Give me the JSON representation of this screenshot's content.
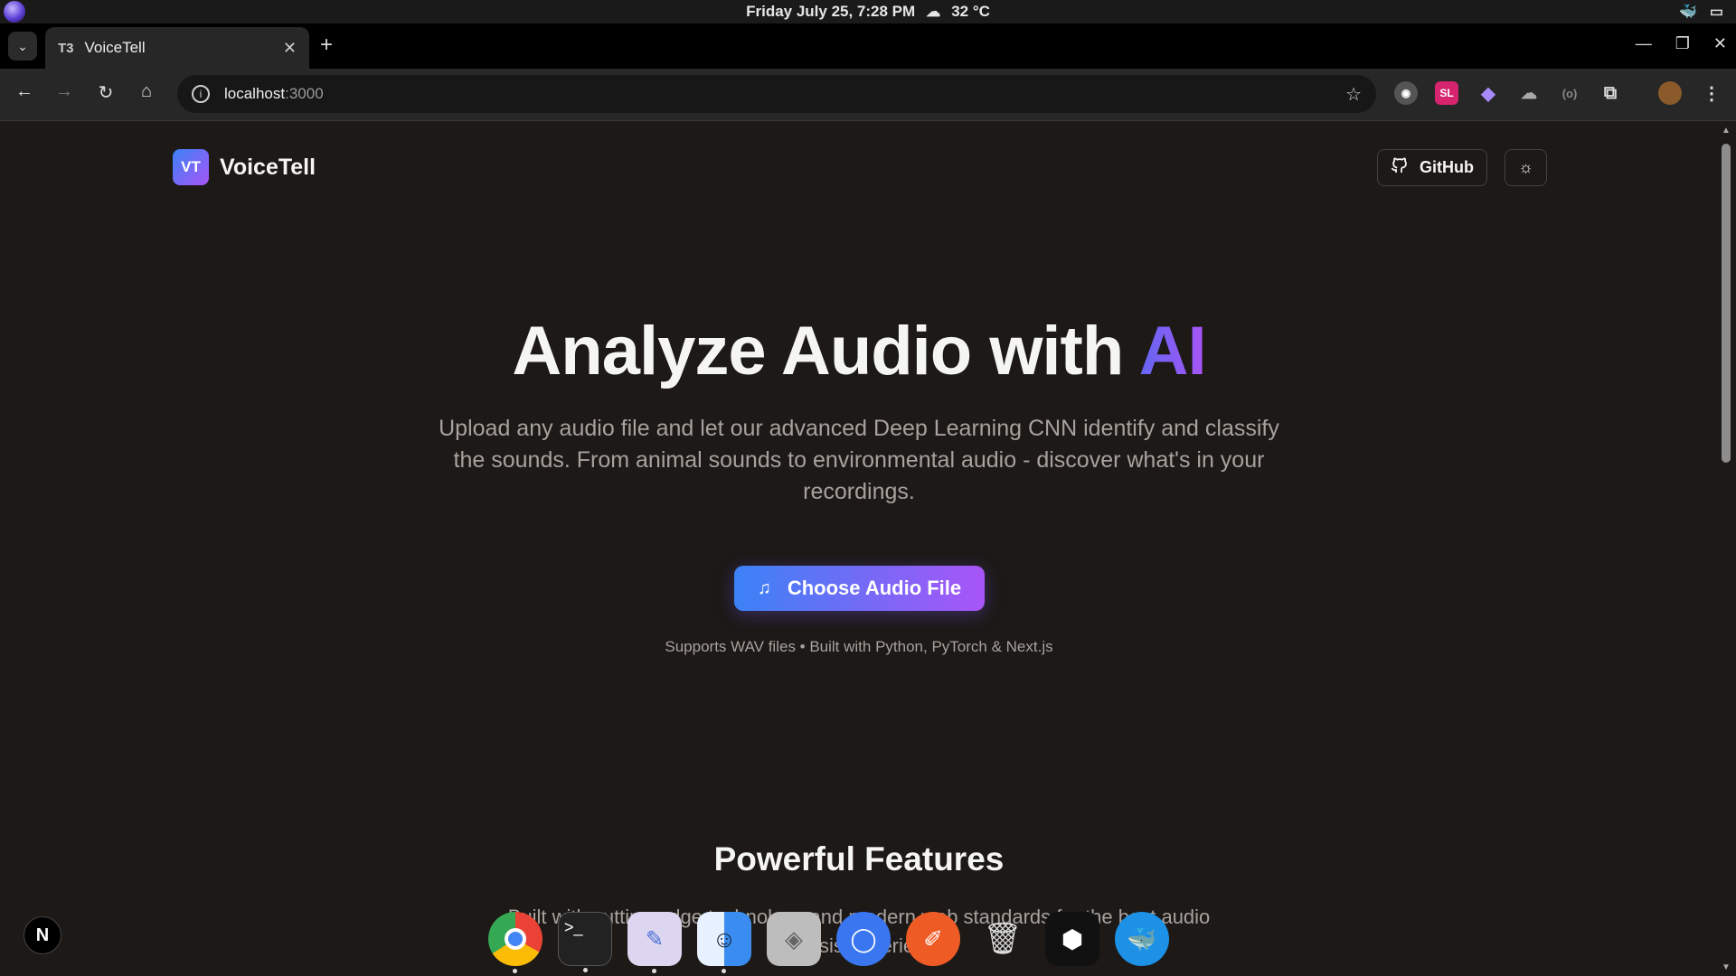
{
  "os_bar": {
    "datetime": "Friday July 25, 7:28 PM",
    "weather_icon": "cloud-icon",
    "temperature": "32 °C"
  },
  "browser": {
    "tab_title": "VoiceTell",
    "tab_favicon": "T3",
    "address_host": "localhost",
    "address_port": ":3000"
  },
  "header": {
    "logo_text": "VT",
    "brand_name": "VoiceTell",
    "github_label": "GitHub",
    "theme_toggle_icon": "sun-icon"
  },
  "hero": {
    "title_prefix": "Analyze Audio with ",
    "title_accent": "AI",
    "subtitle": "Upload any audio file and let our advanced Deep Learning CNN identify and classify the sounds. From animal sounds to environmental audio - discover what's in your recordings.",
    "cta_label": "Choose Audio File",
    "supports": "Supports WAV files • Built with Python, PyTorch & Next.js"
  },
  "features": {
    "title": "Powerful Features",
    "subtitle": "Built with cutting-edge technology and modern web standards for the best audio analysis experience"
  },
  "next_badge": "N",
  "colors": {
    "page_bg": "#1c1917",
    "accent_start": "#3b82f6",
    "accent_end": "#a855f7"
  },
  "dock": {
    "apps": [
      "chrome-icon",
      "terminal-icon",
      "text-editor-icon",
      "finder-icon",
      "brave-icon",
      "signal-icon",
      "postman-icon",
      "trash-icon",
      "cube-app-icon",
      "docker-icon"
    ]
  }
}
